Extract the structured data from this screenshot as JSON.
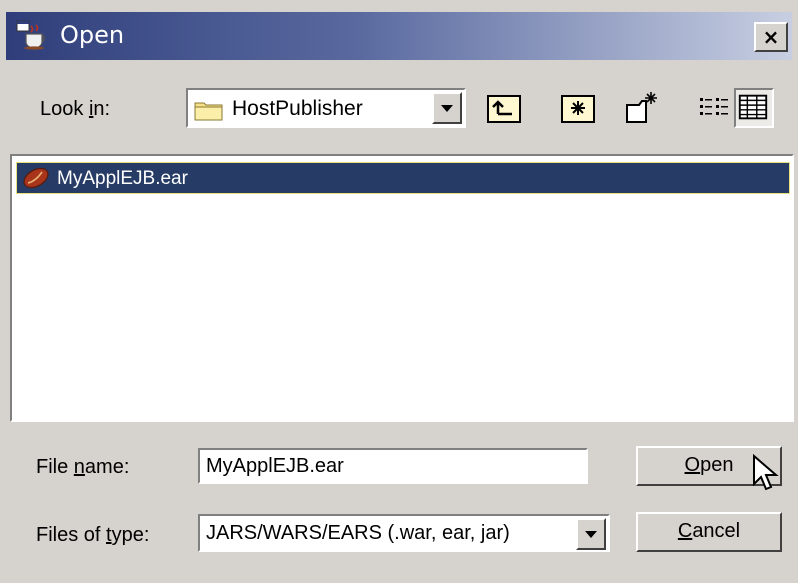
{
  "window": {
    "title": "Open",
    "close_glyph": "×"
  },
  "lookin": {
    "label": "Look in:",
    "value": "HostPublisher"
  },
  "toolbar": {
    "buttons": [
      {
        "icon": "up-one-level-icon"
      },
      {
        "icon": "home-icon"
      },
      {
        "icon": "new-folder-icon"
      },
      {
        "icon": "list-view-icon"
      },
      {
        "icon": "details-view-icon"
      }
    ]
  },
  "files": [
    {
      "name": "MyApplEJB.ear",
      "icon": "bean-icon",
      "selected": true
    }
  ],
  "filename": {
    "label": "File name:",
    "value": "MyApplEJB.ear"
  },
  "filetype": {
    "label": "Files of type:",
    "value": "JARS/WARS/EARS (.war, ear, jar)"
  },
  "buttons": {
    "open": "Open",
    "cancel": "Cancel"
  },
  "colors": {
    "titlebar_start": "#2f3e7a",
    "selection": "#263b66",
    "background": "#d6d3ce"
  }
}
